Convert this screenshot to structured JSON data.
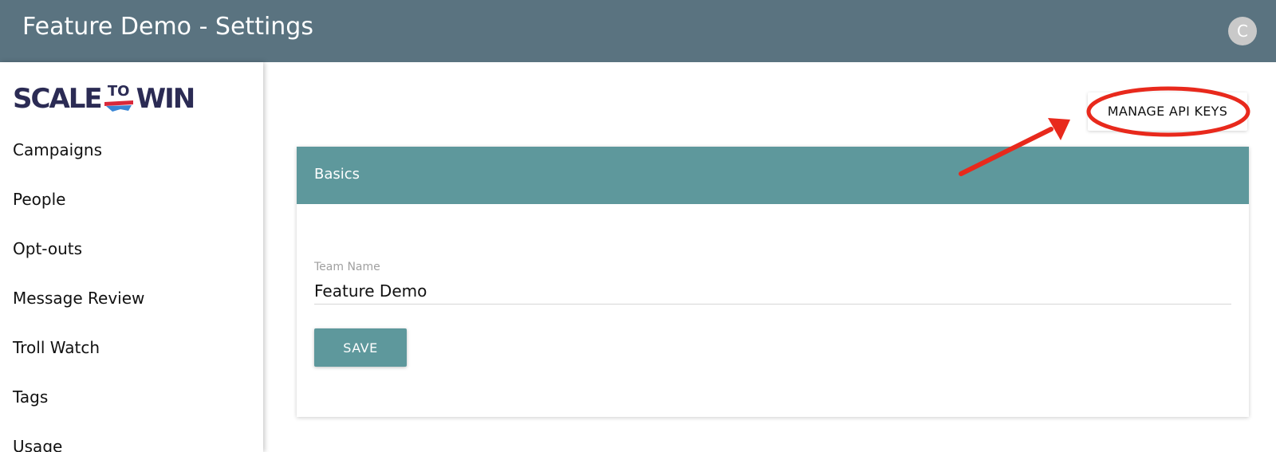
{
  "header": {
    "title": "Feature Demo - Settings",
    "avatar_initial": "C",
    "bg_color": "#5a7380"
  },
  "sidebar": {
    "logo": {
      "left": "SCALE",
      "mid": "TO",
      "right": "WIN"
    },
    "items": [
      {
        "label": "Campaigns"
      },
      {
        "label": "People"
      },
      {
        "label": "Opt-outs"
      },
      {
        "label": "Message Review"
      },
      {
        "label": "Troll Watch"
      },
      {
        "label": "Tags"
      },
      {
        "label": "Usage"
      }
    ]
  },
  "main": {
    "manage_api_keys_label": "MANAGE API KEYS",
    "card": {
      "title": "Basics",
      "header_color": "#5e989c",
      "team_name": {
        "label": "Team Name",
        "value": "Feature Demo"
      },
      "save_label": "SAVE"
    }
  },
  "annotation": {
    "color": "#e8291c",
    "description_shapes": [
      "ellipse-highlight",
      "arrow"
    ]
  }
}
